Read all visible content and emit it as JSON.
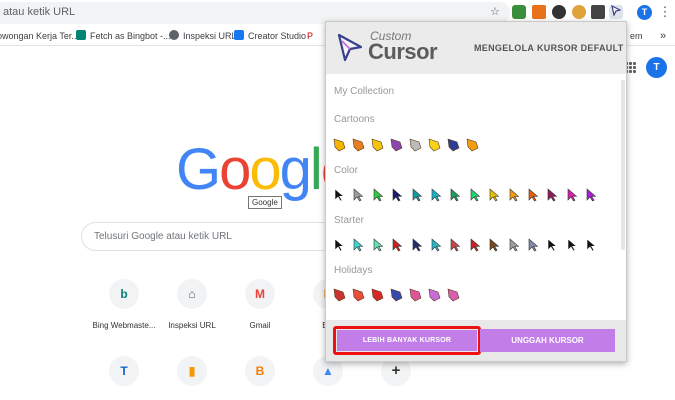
{
  "browser": {
    "url_text": "atau ketik URL",
    "profile_initial": "T",
    "bookmarks": [
      {
        "label": "owongan Kerja Ter...",
        "color": "#1a73e8"
      },
      {
        "label": "Fetch as Bingbot -...",
        "color": "#008373"
      },
      {
        "label": "Inspeksi URL",
        "color": "#5f6368"
      },
      {
        "label": "Creator Studio",
        "color": "#1877f2"
      },
      {
        "label": "P",
        "color": "#c00"
      },
      {
        "label": "em",
        "color": "#888"
      }
    ],
    "bookmarks_more": "»",
    "toolbar_star": "☆",
    "toolbar_menu": "⋮"
  },
  "ntp": {
    "logo_letters": [
      "G",
      "o",
      "o",
      "g",
      "l",
      "e"
    ],
    "logo_colors": [
      "#4285f4",
      "#ea4335",
      "#fbbc05",
      "#4285f4",
      "#34a853",
      "#ea4335"
    ],
    "logo_tooltip": "Google",
    "search_placeholder": "Telusuri Google atau ketik URL",
    "shortcuts_row1": [
      {
        "label": "Bing Webmaste...",
        "glyph": "b",
        "color": "#008373"
      },
      {
        "label": "Inspeksi URL",
        "glyph": "⌂",
        "color": "#5f6368"
      },
      {
        "label": "Gmail",
        "glyph": "M",
        "color": "#ea4335"
      },
      {
        "label": "Blo",
        "glyph": "B",
        "color": "#f57d00"
      }
    ],
    "shortcuts_row2": [
      {
        "glyph": "T",
        "color": "#1c64c8"
      },
      {
        "glyph": "▮",
        "color": "#f29900"
      },
      {
        "glyph": "B",
        "color": "#f57d00"
      },
      {
        "glyph": "▲",
        "color": "#4285f4"
      },
      {
        "glyph": "+",
        "color": "#333333"
      }
    ],
    "profile_initial": "T"
  },
  "popup": {
    "brand_top": "Custom",
    "brand_bottom": "Cursor",
    "nav": {
      "manage": "MENGELOLA",
      "default": "KURSOR DEFAULT"
    },
    "sections": {
      "collection": "My Collection",
      "cartoons": "Cartoons",
      "color": "Color",
      "starter": "Starter",
      "holidays": "Holidays"
    },
    "cartoon_colors": [
      "#f4b400",
      "#e67e22",
      "#f1c40f",
      "#8e44ad",
      "#bbbbbb",
      "#f7d21a",
      "#2c3e91",
      "#f39c12"
    ],
    "color_cursors": [
      "#111111",
      "#9e9e9e",
      "#2ecc40",
      "#1a1a6e",
      "#0f9d9d",
      "#19b5c7",
      "#1aa05a",
      "#1ed66a",
      "#e6c200",
      "#f39c12",
      "#e85d04",
      "#8e1b5a",
      "#d41ea6",
      "#a61ed4"
    ],
    "starter_colors": [
      "#111111",
      "#3dd6d0",
      "#66e0b0",
      "#cc2222",
      "#1f2d6e",
      "#27b8c8",
      "#c44",
      "#cc2222",
      "#7a4a1a",
      "#9e9e9e",
      "#7b8ba8",
      "#111111",
      "#111111",
      "#111111"
    ],
    "holiday_colors": [
      "#cc3333",
      "#e74c3c",
      "#d62828",
      "#3949ab",
      "#e05599",
      "#c86dd7",
      "#d65fb0"
    ],
    "buttons": {
      "more": "LEBIH BANYAK KURSOR",
      "upload": "UNGGAH KURSOR"
    }
  }
}
